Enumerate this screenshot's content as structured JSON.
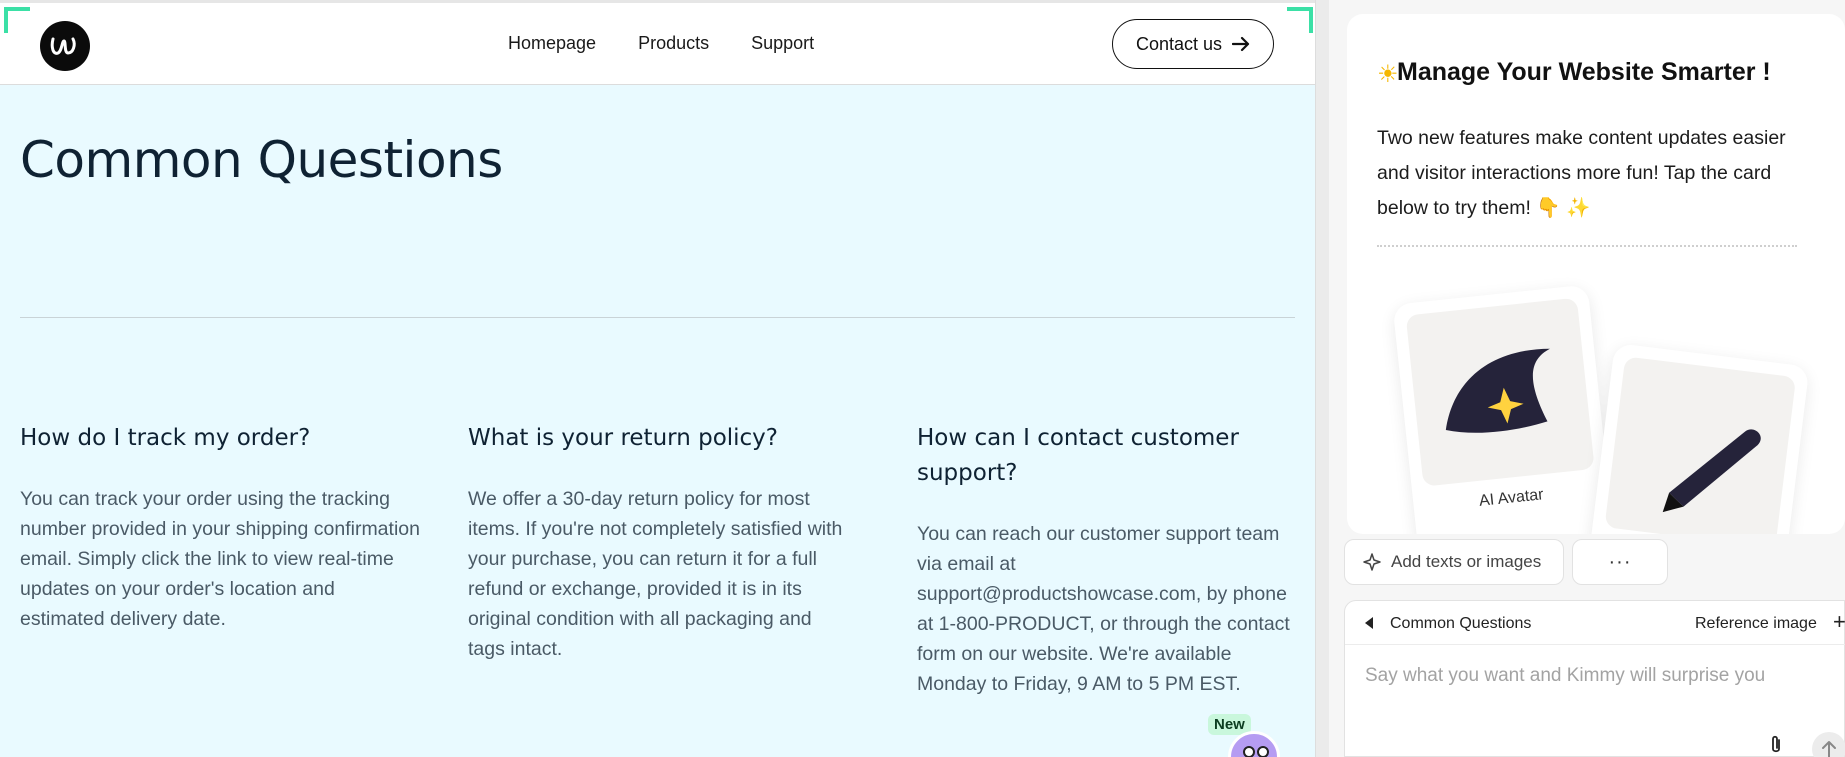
{
  "site": {
    "nav": [
      "Homepage",
      "Products",
      "Support"
    ],
    "contact_label": "Contact us",
    "page_title": "Common Questions",
    "faqs": [
      {
        "q": "How do I track my order?",
        "a": "You can track your order using the tracking number provided in your shipping confirmation email. Simply click the link to view real-time updates on your order's location and estimated delivery date."
      },
      {
        "q": "What is your return policy?",
        "a": "We offer a 30-day return policy for most items. If you're not completely satisfied with your purchase, you can return it for a full refund or exchange, provided it is in its original condition with all packaging and tags intact."
      },
      {
        "q": "How can I contact customer support?",
        "a": "You can reach our customer support team via email at support@productshowcase.com, by phone at 1-800-PRODUCT, or through the contact form on our website. We're available Monday to Friday, 9 AM to 5 PM EST."
      }
    ],
    "new_badge": "New",
    "accent_color": "#3be0a6",
    "background_color": "#e9faff"
  },
  "panel": {
    "card": {
      "title": "Manage Your Website Smarter !",
      "body": "Two new features make content updates easier and visitor interactions more fun! Tap the card below to try them! 👇 ✨",
      "features": [
        {
          "label": "AI Avatar"
        },
        {
          "label": ""
        }
      ]
    },
    "toolbar": {
      "add_label": "Add texts or images",
      "more_label": "···"
    },
    "composer": {
      "context_label": "Common Questions",
      "reference_label": "Reference image",
      "plus_label": "+",
      "placeholder": "Say what you want and Kimmy will surprise you"
    }
  }
}
